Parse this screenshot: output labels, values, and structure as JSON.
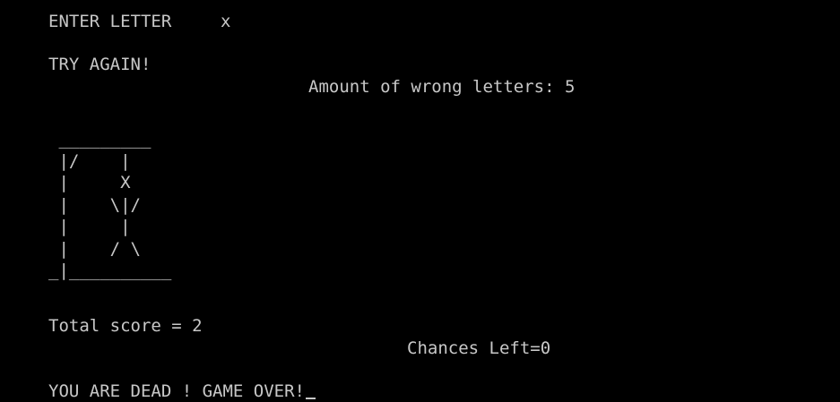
{
  "prompt": {
    "label": "ENTER LETTER",
    "typed_letter": "x"
  },
  "status": {
    "try_again": "TRY AGAIN!",
    "wrong_letters_label": "Amount of wrong letters: 5"
  },
  "hangman": {
    "drawing": " _________\n |/    |\n |     X\n |    \\|/\n |     |\n |    / \\\n_|__________"
  },
  "score": {
    "total_score_label": "Total score = 2",
    "chances_label": "Chances Left=0"
  },
  "result": {
    "message": "YOU ARE DEAD ! GAME OVER!"
  },
  "colors": {
    "background": "#000000",
    "text": "#c8c8c8"
  }
}
